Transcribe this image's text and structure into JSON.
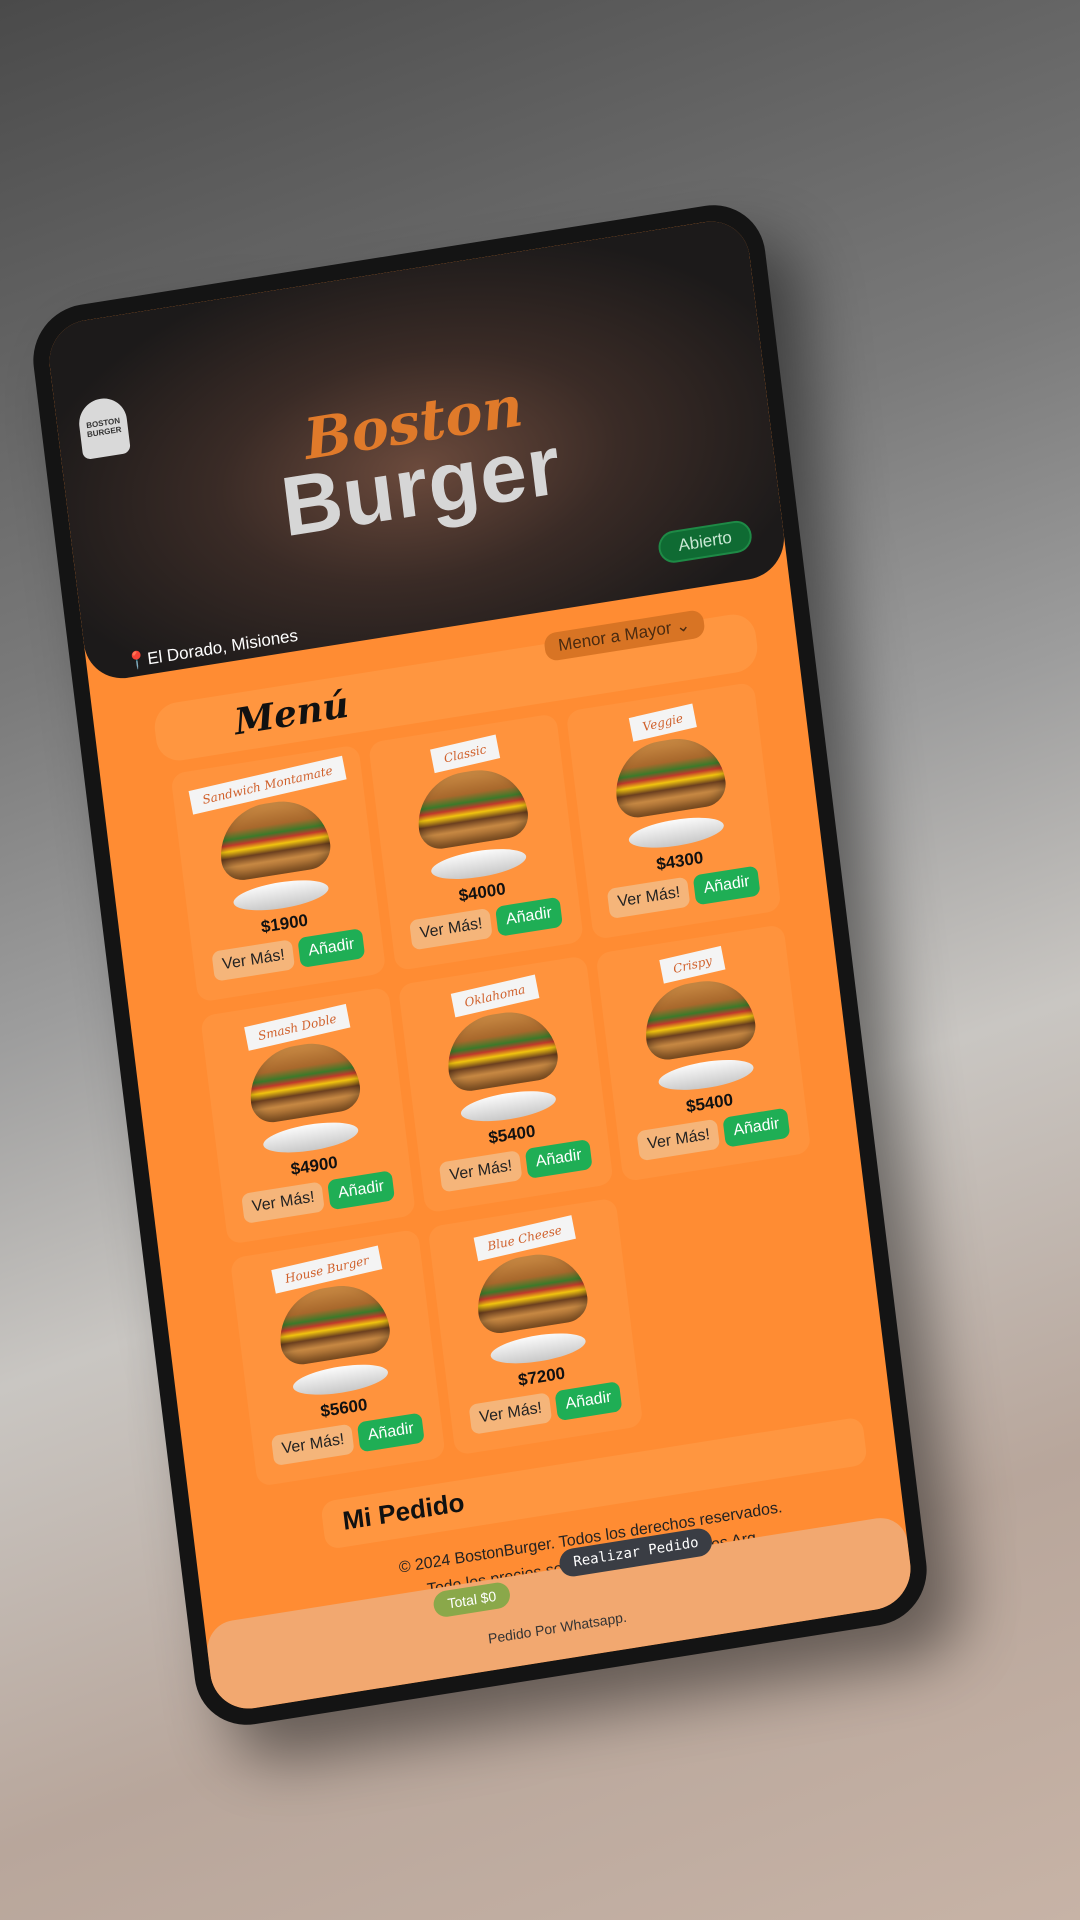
{
  "hero": {
    "brand_top": "Boston",
    "brand_main": "Burger",
    "logo_text": "BOSTON BURGER",
    "status": "Abierto",
    "location": "El Dorado, Misiones"
  },
  "sort": {
    "selected": "Menor a Mayor"
  },
  "menu": {
    "title": "Menú",
    "items": [
      {
        "name": "Sandwich Montamate",
        "price": "$1900",
        "more_label": "Ver Más!",
        "add_label": "Añadir"
      },
      {
        "name": "Classic",
        "price": "$4000",
        "more_label": "Ver Más!",
        "add_label": "Añadir"
      },
      {
        "name": "Veggie",
        "price": "$4300",
        "more_label": "Ver Más!",
        "add_label": "Añadir"
      },
      {
        "name": "Smash Doble",
        "price": "$4900",
        "more_label": "Ver Más!",
        "add_label": "Añadir"
      },
      {
        "name": "Oklahoma",
        "price": "$5400",
        "more_label": "Ver Más!",
        "add_label": "Añadir"
      },
      {
        "name": "Crispy",
        "price": "$5400",
        "more_label": "Ver Más!",
        "add_label": "Añadir"
      },
      {
        "name": "House Burger",
        "price": "$5600",
        "more_label": "Ver Más!",
        "add_label": "Añadir"
      },
      {
        "name": "Blue Cheese",
        "price": "$7200",
        "more_label": "Ver Más!",
        "add_label": "Añadir"
      }
    ]
  },
  "order": {
    "title": "Mi Pedido",
    "footer_line1": "© 2024 BostonBurger. Todos los derechos reservados.",
    "footer_line2": "Todo los precios son expresados en Pesos Arg.",
    "total": "Total $0",
    "submit_label": "Realizar Pedido",
    "whatsapp_note": "Pedido Por Whatsapp."
  },
  "colors": {
    "accent": "#ff8c33",
    "add_button": "#1fae55",
    "status_pill": "#0f6b33"
  }
}
